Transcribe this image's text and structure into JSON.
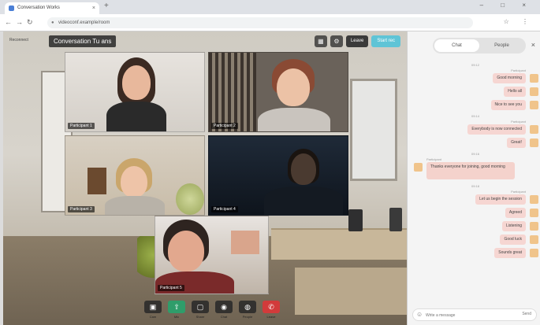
{
  "browser": {
    "tab_title": "Conversation Works",
    "url": "videoconf.example/room",
    "new_tab_glyph": "+",
    "window_controls": "– □ ×"
  },
  "meeting": {
    "badge": "Conversation Tu ans",
    "leave_label": "Leave",
    "start_label": "Start rec",
    "left_label": "Reconnect"
  },
  "participants": [
    {
      "name": "Participant 1"
    },
    {
      "name": "Participant 2"
    },
    {
      "name": "Participant 3"
    },
    {
      "name": "Participant 4"
    },
    {
      "name": "Participant 5"
    }
  ],
  "controls": [
    {
      "label": "Cam",
      "glyph": "▣"
    },
    {
      "label": "Mic",
      "glyph": "⇧"
    },
    {
      "label": "Share",
      "glyph": "▢"
    },
    {
      "label": "Chat",
      "glyph": "◉"
    },
    {
      "label": "People",
      "glyph": "◍"
    },
    {
      "label": "Leave",
      "glyph": "✆"
    }
  ],
  "panel": {
    "tab_chat": "Chat",
    "tab_people": "People",
    "close_glyph": "×",
    "composer_placeholder": "Write a message",
    "send_label": "Send"
  },
  "chat": {
    "groups": [
      {
        "time": "09:12",
        "sender": "Participant",
        "side": "right",
        "messages": [
          "Good morning",
          "Hello all",
          "Nice to see you"
        ]
      },
      {
        "time": "09:14",
        "sender": "Participant",
        "side": "right",
        "messages": [
          "Everybody is now connected",
          "Great!"
        ]
      },
      {
        "time": "09:16",
        "sender": "Participant",
        "side": "left",
        "messages": [
          "Thanks everyone for joining, good morning"
        ]
      },
      {
        "time": "09:18",
        "sender": "Participant",
        "side": "right",
        "messages": [
          "Let us begin the session",
          "Agreed",
          "Listening",
          "Good luck",
          "Sounds great"
        ]
      }
    ]
  },
  "colors": {
    "accent": "#5fc4d6",
    "share_green": "#2f9d6a",
    "leave_red": "#d23b3b",
    "bubble": "#f6d6d2"
  }
}
